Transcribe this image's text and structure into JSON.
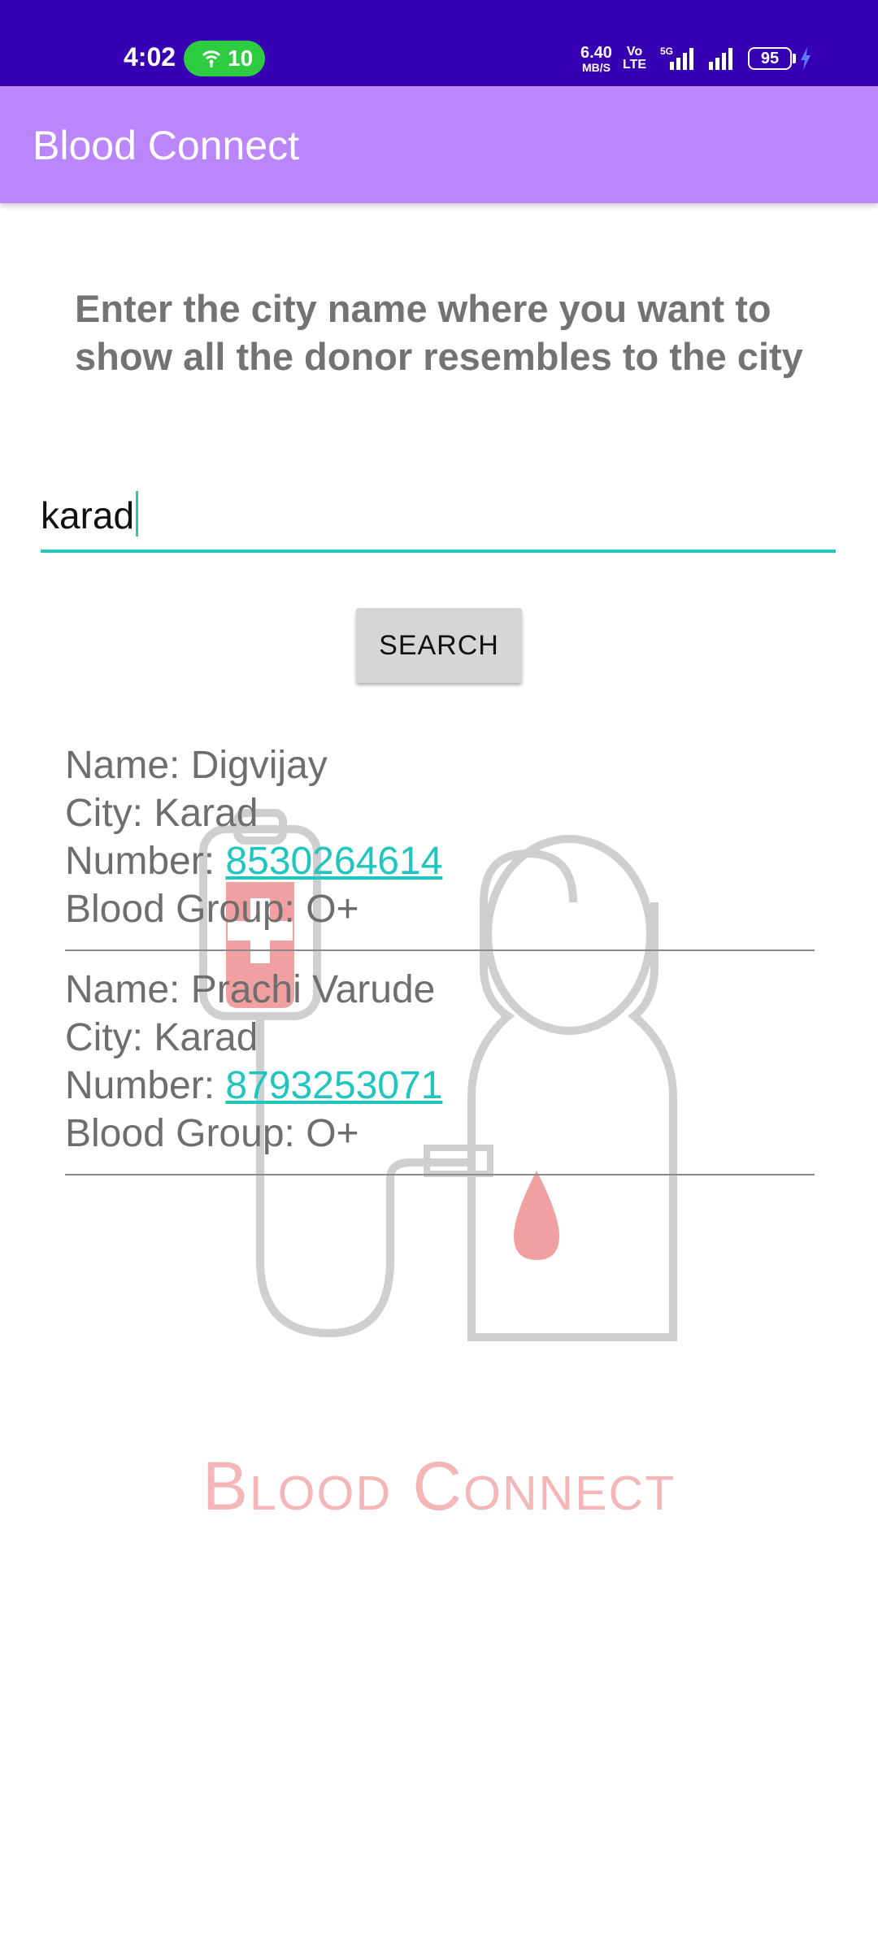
{
  "status_bar": {
    "time": "4:02",
    "hotspot_count": "10",
    "net_speed_value": "6.40",
    "net_speed_unit": "MB/S",
    "volte_top": "Vo",
    "volte_bottom": "LTE",
    "network_type": "5G",
    "battery_level": "95"
  },
  "app_bar": {
    "title": "Blood Connect"
  },
  "search": {
    "instruction": "Enter the city name where you want to show all the donor resembles to the city",
    "city_value": "karad",
    "button_label": "SEARCH"
  },
  "donors": [
    {
      "name_label": "Name: ",
      "name": "Digvijay",
      "city_label": "City: ",
      "city": "Karad",
      "number_label": "Number: ",
      "number": "8530264614",
      "blood_label": "Blood Group: ",
      "blood_group": "O+"
    },
    {
      "name_label": "Name: ",
      "name": "Prachi Varude",
      "city_label": "City: ",
      "city": "Karad",
      "number_label": "Number: ",
      "number": "8793253071",
      "blood_label": "Blood Group: ",
      "blood_group": "O+"
    }
  ],
  "watermark": {
    "text": "Blood Connect"
  },
  "colors": {
    "status_bar": "#3700b3",
    "app_bar": "#bb86fc",
    "accent": "#26c6be",
    "watermark_red": "#f0a0a0"
  }
}
